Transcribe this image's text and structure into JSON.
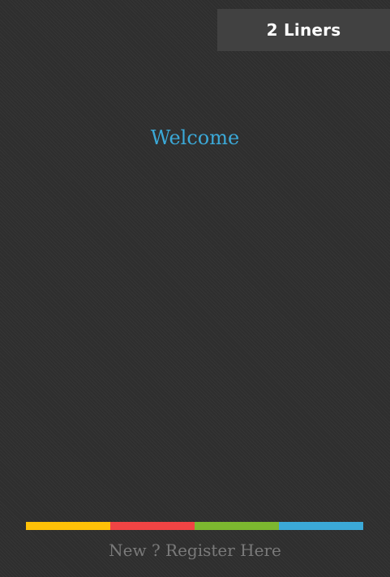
{
  "header": {
    "app_name": "2 Liners"
  },
  "main": {
    "welcome_text": "Welcome"
  },
  "color_bar": {
    "colors": [
      "#ffc107",
      "#f04444",
      "#7cb82f",
      "#3ba9d8"
    ]
  },
  "footer": {
    "register_link": "New ? Register Here"
  },
  "theme": {
    "accent": "#3ba9d8",
    "background": "#2e2e2e",
    "badge_background": "#414141",
    "link_color": "#7a7a7a"
  }
}
